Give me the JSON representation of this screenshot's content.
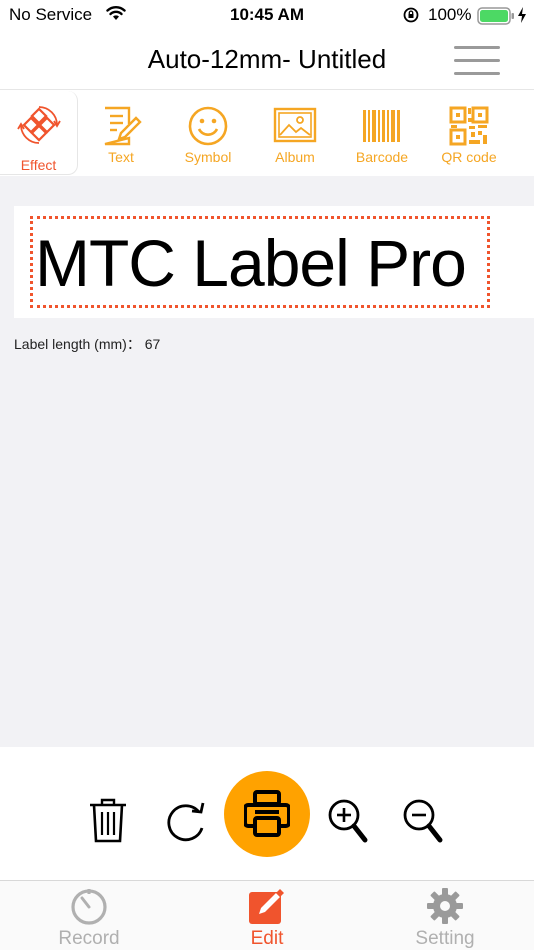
{
  "status_bar": {
    "carrier": "No Service",
    "time": "10:45 AM",
    "battery_percent": "100%"
  },
  "nav": {
    "title": "Auto-12mm- Untitled"
  },
  "toolbar": {
    "items": [
      {
        "label": "Effect",
        "icon": "effect-icon",
        "selected": true
      },
      {
        "label": "Text",
        "icon": "text-edit-icon"
      },
      {
        "label": "Symbol",
        "icon": "smiley-icon"
      },
      {
        "label": "Album",
        "icon": "image-icon"
      },
      {
        "label": "Barcode",
        "icon": "barcode-icon"
      },
      {
        "label": "QR code",
        "icon": "qr-code-icon"
      }
    ]
  },
  "label": {
    "text": "MTC Label Pro",
    "length_info": "Label length (mm)： 67"
  },
  "actions": {
    "items": [
      "trash-icon",
      "rotate-icon",
      "print-icon",
      "zoom-in-icon",
      "zoom-out-icon"
    ]
  },
  "tabbar": {
    "tabs": [
      {
        "label": "Record",
        "icon": "timer-icon"
      },
      {
        "label": "Edit",
        "icon": "edit-icon",
        "active": true
      },
      {
        "label": "Setting",
        "icon": "gear-icon"
      }
    ]
  },
  "colors": {
    "accent_orange": "#f5a623",
    "effect_red": "#f0542d",
    "print_button": "#ffa200",
    "canvas_bg": "#f2f2f5"
  }
}
